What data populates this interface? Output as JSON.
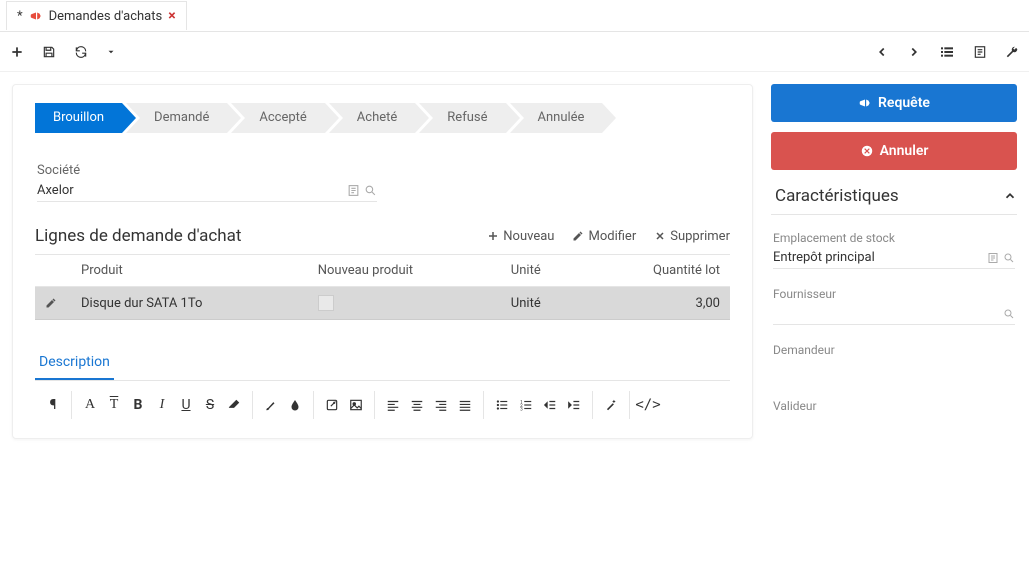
{
  "tab": {
    "title": "Demandes d'achats",
    "dirty_marker": "*"
  },
  "workflow": {
    "steps": [
      "Brouillon",
      "Demandé",
      "Accepté",
      "Acheté",
      "Refusé",
      "Annulée"
    ],
    "active_index": 0
  },
  "form": {
    "company_label": "Société",
    "company_value": "Axelor"
  },
  "lines": {
    "title": "Lignes de demande d'achat",
    "actions": {
      "new": "Nouveau",
      "edit": "Modifier",
      "delete": "Supprimer"
    },
    "columns": {
      "product": "Produit",
      "new_product": "Nouveau produit",
      "unit": "Unité",
      "qty": "Quantité lot"
    },
    "rows": [
      {
        "product": "Disque dur SATA 1To",
        "new_product": false,
        "unit": "Unité",
        "qty": "3,00"
      }
    ]
  },
  "tabs2": {
    "description": "Description"
  },
  "side": {
    "request_btn": "Requête",
    "cancel_btn": "Annuler",
    "panel_title": "Caractéristiques",
    "stock_loc_label": "Emplacement de stock",
    "stock_loc_value": "Entrepôt principal",
    "supplier_label": "Fournisseur",
    "requester_label": "Demandeur",
    "validator_label": "Valideur"
  }
}
